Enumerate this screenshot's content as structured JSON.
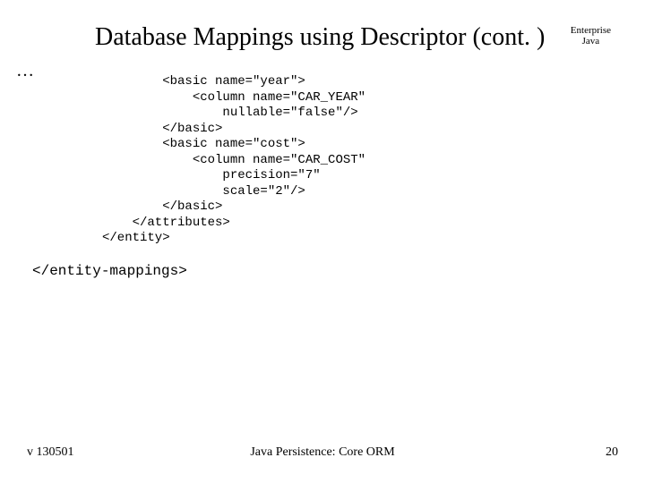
{
  "header": {
    "title": "Database Mappings using Descriptor (cont. )",
    "corner_line1": "Enterprise",
    "corner_line2": "Java"
  },
  "body": {
    "ellipsis": "…",
    "code": "        <basic name=\"year\">\n            <column name=\"CAR_YEAR\"\n                nullable=\"false\"/>\n        </basic>\n        <basic name=\"cost\">\n            <column name=\"CAR_COST\"\n                precision=\"7\"\n                scale=\"2\"/>\n        </basic>\n    </attributes>\n</entity>",
    "closing_tag": "</entity-mappings>"
  },
  "footer": {
    "left": "v 130501",
    "center": "Java Persistence: Core ORM",
    "right": "20"
  }
}
